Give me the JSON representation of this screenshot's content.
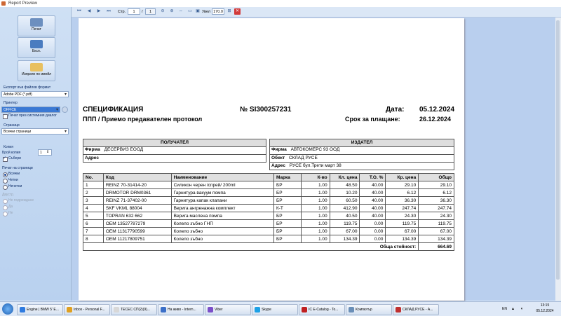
{
  "window": {
    "title": "Report Preview"
  },
  "sidebar": {
    "print_label": "Печат",
    "export_label": "Експ.",
    "send_label": "Изпрати по имейл",
    "export_format_label": "Експорт във файлов формат",
    "export_format_value": "Adobe PDF (*.pdf)",
    "printer_label": "Принтер",
    "printer_value": "OFFICE",
    "print_system_dialog_label": "Печат през системния диалог",
    "pages_label": "Страници",
    "pages_value": "Всички страници",
    "copies_section_label": "Копия",
    "copies_count_label": "Брой копия",
    "copies_count_value": "1",
    "collate_label": "Събери",
    "print_on_pages_label": "Печат на страници",
    "radio_all": "Всички",
    "radio_even": "Четни",
    "radio_odd": "Нечетни",
    "duplex_label": "Двустр.",
    "duplex_none": "Не подреждане",
    "duplex_yes": "Да",
    "duplex_no": "Не"
  },
  "toolbar": {
    "page_label": "Стр.",
    "page_current": "1",
    "page_separator": "/",
    "page_total": "1",
    "zoom_label": "Увел",
    "zoom_value": "170.0"
  },
  "document": {
    "title": "СПЕЦИФИКАЦИЯ",
    "subtitle": "ППП / Приемо предавателен протокол",
    "number": "№ SI300257231",
    "date_label": "Дата:",
    "date_value": "05.12.2024",
    "due_label": "Срок за плащане:",
    "due_value": "26.12.2024",
    "recipient": {
      "header": "ПОЛУЧАТЕЛ",
      "firm_label": "Фирма",
      "firm_value": "ДЕСЕРВИЗ ЕООД",
      "address_label": "Адрес",
      "address_value": ""
    },
    "issuer": {
      "header": "ИЗДАТЕЛ",
      "firm_label": "Фирма",
      "firm_value": "АВТОКОМЕРС 93 ООД",
      "object_label": "Обект",
      "object_value": "СКЛАД РУСЕ",
      "address_label": "Адрес",
      "address_value": "РУСЕ бул.Трети март 38"
    },
    "table": {
      "headers": [
        "No.",
        "Код",
        "Наименование",
        "Марка",
        "К-во",
        "Кл. цена",
        "Т.О. %",
        "Кр. цена",
        "Общо"
      ],
      "rows": [
        [
          "1",
          "REINZ 70-31414-20",
          "Силикон черен /спрей/ 200ml",
          "БР",
          "1.00",
          "48.50",
          "40.00",
          "29.10",
          "29.10"
        ],
        [
          "2",
          "DRMOTOR DRM0361",
          "Гарнитура вакуум помпа",
          "БР",
          "1.00",
          "10.20",
          "40.00",
          "6.12",
          "6.12"
        ],
        [
          "3",
          "REINZ 71-37402-00",
          "Гарнитура капак клапани",
          "БР",
          "1.00",
          "60.50",
          "40.00",
          "36.30",
          "36.30"
        ],
        [
          "4",
          "SKF VKML 88004",
          "Верига ангренажна комплект",
          "К-Т",
          "1.00",
          "412.90",
          "40.00",
          "247.74",
          "247.74"
        ],
        [
          "5",
          "TOPRAN 632 662",
          "Верига маслена помпа",
          "БР",
          "1.00",
          "40.50",
          "40.00",
          "24.30",
          "24.30"
        ],
        [
          "6",
          "OEM 13527787279",
          "Колело зъбно ГНП",
          "БР",
          "1.00",
          "119.75",
          "0.00",
          "119.75",
          "119.75"
        ],
        [
          "7",
          "OEM 11317790599",
          "Колело зъбно",
          "БР",
          "1.00",
          "67.00",
          "0.00",
          "67.00",
          "67.00"
        ],
        [
          "8",
          "OEM 11217809751",
          "Колело зъбно",
          "БР",
          "1.00",
          "134.39",
          "0.00",
          "134.39",
          "134.39"
        ]
      ],
      "total_label": "Обща стойност:",
      "total_value": "664.69"
    }
  },
  "taskbar": {
    "tasks": [
      {
        "label": "Engine | BMW 5' E...",
        "color": "#2f7be0"
      },
      {
        "label": "Inbox - Personal F...",
        "color": "#e0a020"
      },
      {
        "label": "ТЕСЕС СП(2)(9)...",
        "color": "#d8d8d8"
      },
      {
        "label": "На живо - Intern...",
        "color": "#3b6fc8"
      },
      {
        "label": "Viber",
        "color": "#7b4fc9"
      },
      {
        "label": "Skype",
        "color": "#1da1e6"
      },
      {
        "label": "IC E-Catalog - To...",
        "color": "#c02020"
      },
      {
        "label": "Компютър",
        "color": "#6a8fb8"
      },
      {
        "label": "СКЛАД РУСЕ - А...",
        "color": "#c03030"
      }
    ],
    "lang": "EN",
    "time": "13:15",
    "date": "05.12.2024"
  }
}
